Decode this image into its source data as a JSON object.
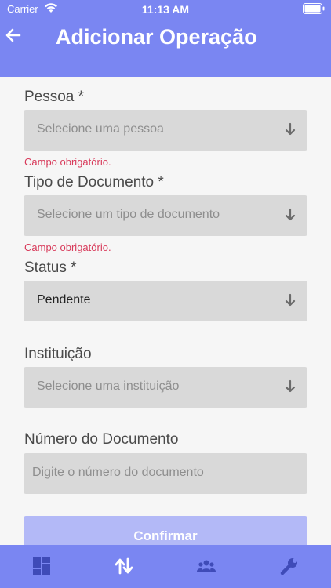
{
  "status_bar": {
    "carrier": "Carrier",
    "time": "11:13 AM"
  },
  "header": {
    "title": "Adicionar Operação",
    "back_icon": "back-arrow-icon"
  },
  "form": {
    "pessoa": {
      "label": "Pessoa *",
      "placeholder": "Selecione uma pessoa",
      "error": "Campo obrigatório."
    },
    "tipo_documento": {
      "label": "Tipo de Documento *",
      "placeholder": "Selecione um tipo de documento",
      "error": "Campo obrigatório."
    },
    "status": {
      "label": "Status *",
      "value": "Pendente"
    },
    "instituicao": {
      "label": "Instituição",
      "placeholder": "Selecione uma instituição"
    },
    "numero_documento": {
      "label": "Número do Documento",
      "placeholder": "Digite o número do documento"
    }
  },
  "confirm_label": "Confirmar",
  "tabs": [
    {
      "icon": "dashboard-icon",
      "active": false
    },
    {
      "icon": "transfer-arrows-icon",
      "active": true
    },
    {
      "icon": "people-icon",
      "active": false
    },
    {
      "icon": "wrench-icon",
      "active": false
    }
  ],
  "colors": {
    "primary": "#7a86f2",
    "button_disabled": "#b3b9f7",
    "error": "#d83a5a",
    "field_bg": "#d9d9d9"
  }
}
